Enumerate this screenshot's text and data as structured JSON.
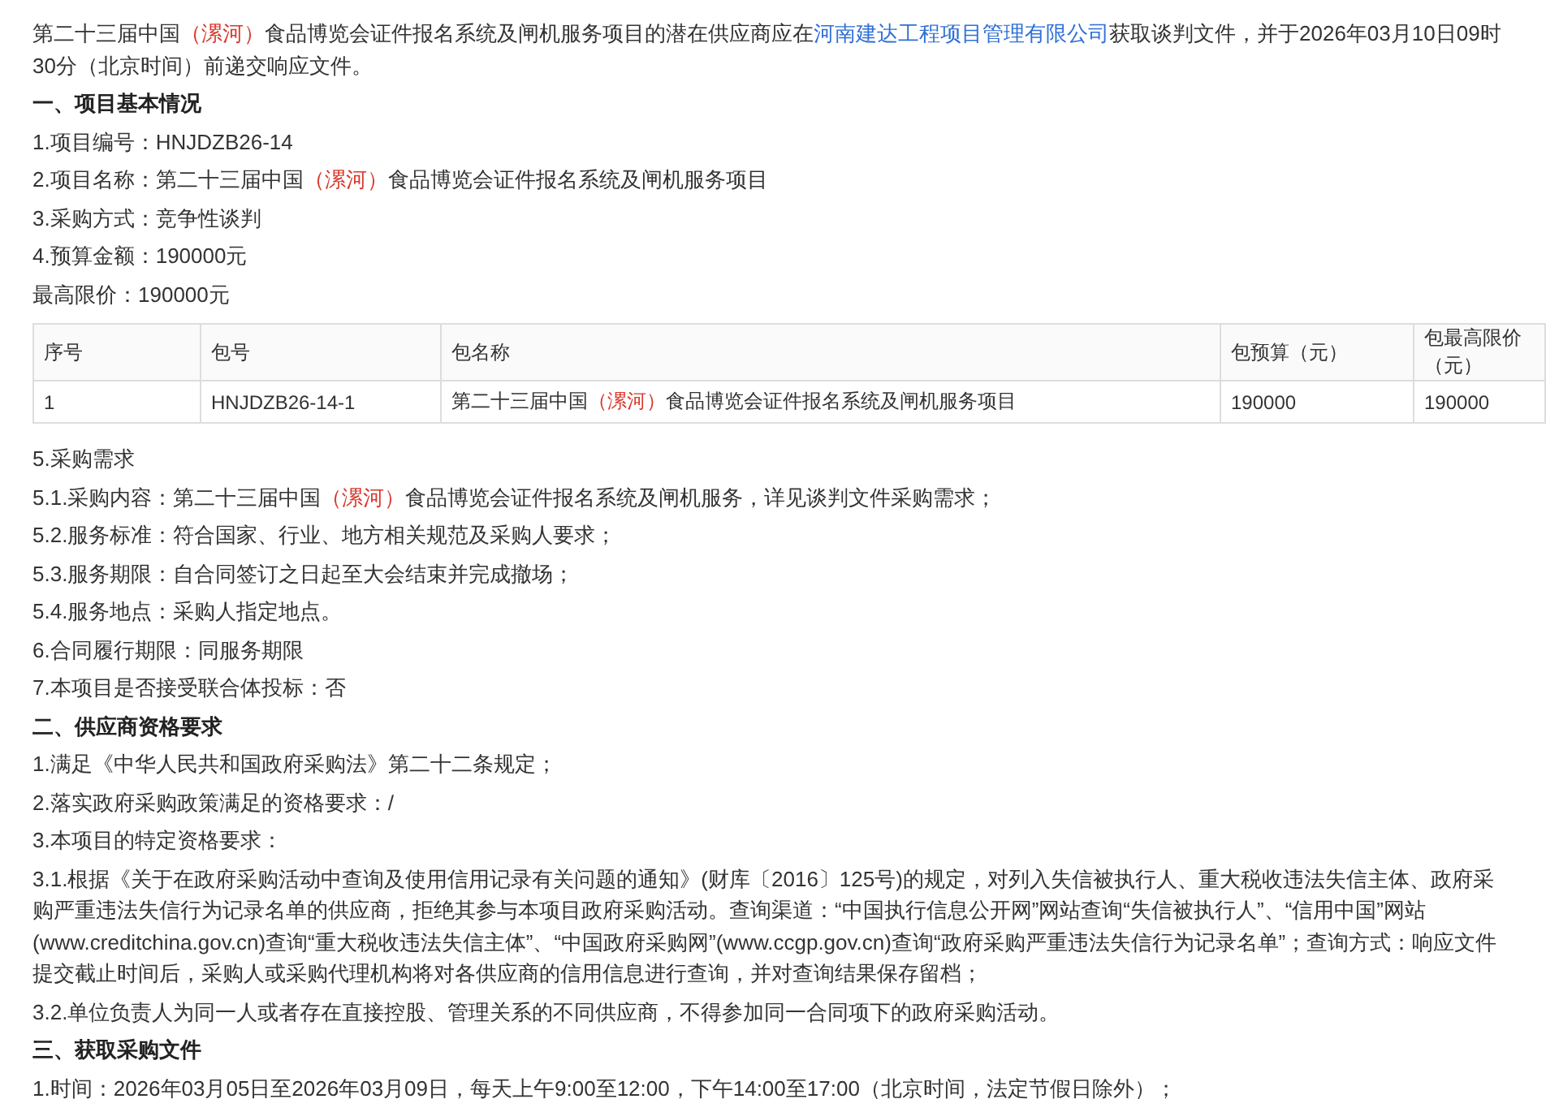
{
  "blocks": [
    {
      "kind": "paragraph",
      "segments": [
        {
          "kind": "text",
          "text": "第二十三届中国"
        },
        {
          "kind": "region",
          "text": "（漯河）"
        },
        {
          "kind": "text",
          "text": "食品博览会证件报名系统及闸机服务项目的潜在供应商应在"
        },
        {
          "kind": "link",
          "text": "河南建达工程项目管理有限公司"
        },
        {
          "kind": "text",
          "text": "获取谈判文件，并于2026年03月10日09时30分（北京时间）前递交响应文件。"
        }
      ]
    },
    {
      "kind": "heading",
      "segments": [
        {
          "kind": "text",
          "text": "一、项目基本情况"
        }
      ]
    },
    {
      "kind": "paragraph",
      "segments": [
        {
          "kind": "text",
          "text": "1.项目编号：HNJDZB26-14"
        }
      ]
    },
    {
      "kind": "paragraph",
      "segments": [
        {
          "kind": "text",
          "text": "2.项目名称：第二十三届中国"
        },
        {
          "kind": "region",
          "text": "（漯河）"
        },
        {
          "kind": "text",
          "text": "食品博览会证件报名系统及闸机服务项目"
        }
      ]
    },
    {
      "kind": "paragraph",
      "segments": [
        {
          "kind": "text",
          "text": "3.采购方式：竞争性谈判"
        }
      ]
    },
    {
      "kind": "paragraph",
      "segments": [
        {
          "kind": "text",
          "text": "4.预算金额：190000元"
        }
      ]
    },
    {
      "kind": "paragraph",
      "segments": [
        {
          "kind": "text",
          "text": "最高限价：190000元"
        }
      ]
    },
    {
      "kind": "table",
      "columns": [
        "序号",
        "包号",
        "包名称",
        "包预算（元）",
        "包最高限价（元）"
      ],
      "rows": [
        [
          [
            {
              "kind": "text",
              "text": "1"
            }
          ],
          [
            {
              "kind": "text",
              "text": "HNJDZB26-14-1"
            }
          ],
          [
            {
              "kind": "text",
              "text": "第二十三届中国"
            },
            {
              "kind": "region",
              "text": "（漯河）"
            },
            {
              "kind": "text",
              "text": "食品博览会证件报名系统及闸机服务项目"
            }
          ],
          [
            {
              "kind": "text",
              "text": "190000"
            }
          ],
          [
            {
              "kind": "text",
              "text": "190000"
            }
          ]
        ]
      ]
    },
    {
      "kind": "paragraph",
      "segments": [
        {
          "kind": "text",
          "text": "5.采购需求"
        }
      ]
    },
    {
      "kind": "paragraph",
      "segments": [
        {
          "kind": "text",
          "text": "5.1.采购内容：第二十三届中国"
        },
        {
          "kind": "region",
          "text": "（漯河）"
        },
        {
          "kind": "text",
          "text": "食品博览会证件报名系统及闸机服务，详见谈判文件采购需求；"
        }
      ]
    },
    {
      "kind": "paragraph",
      "segments": [
        {
          "kind": "text",
          "text": "5.2.服务标准：符合国家、行业、地方相关规范及采购人要求；"
        }
      ]
    },
    {
      "kind": "paragraph",
      "segments": [
        {
          "kind": "text",
          "text": "5.3.服务期限：自合同签订之日起至大会结束并完成撤场；"
        }
      ]
    },
    {
      "kind": "paragraph",
      "segments": [
        {
          "kind": "text",
          "text": "5.4.服务地点：采购人指定地点。"
        }
      ]
    },
    {
      "kind": "paragraph",
      "segments": [
        {
          "kind": "text",
          "text": "6.合同履行期限：同服务期限"
        }
      ]
    },
    {
      "kind": "paragraph",
      "segments": [
        {
          "kind": "text",
          "text": "7.本项目是否接受联合体投标：否"
        }
      ]
    },
    {
      "kind": "heading",
      "segments": [
        {
          "kind": "text",
          "text": "二、供应商资格要求"
        }
      ]
    },
    {
      "kind": "paragraph",
      "segments": [
        {
          "kind": "text",
          "text": "1.满足《中华人民共和国政府采购法》第二十二条规定；"
        }
      ]
    },
    {
      "kind": "paragraph",
      "segments": [
        {
          "kind": "text",
          "text": "2.落实政府采购政策满足的资格要求：/"
        }
      ]
    },
    {
      "kind": "paragraph",
      "segments": [
        {
          "kind": "text",
          "text": "3.本项目的特定资格要求："
        }
      ]
    },
    {
      "kind": "paragraph",
      "segments": [
        {
          "kind": "text",
          "text": "3.1.根据《关于在政府采购活动中查询及使用信用记录有关问题的通知》(财库〔2016〕125号)的规定，对列入失信被执行人、重大税收违法失信主体、政府采购严重违法失信行为记录名单的供应商，拒绝其参与本项目政府采购活动。查询渠道：“中国执行信息公开网”网站查询“失信被执行人”、“信用中国”网站(www.creditchina.gov.cn)查询“重大税收违法失信主体”、“中国政府采购网”(www.ccgp.gov.cn)查询“政府采购严重违法失信行为记录名单”；查询方式：响应文件提交截止时间后，采购人或采购代理机构将对各供应商的信用信息进行查询，并对查询结果保存留档；"
        }
      ]
    },
    {
      "kind": "paragraph",
      "segments": [
        {
          "kind": "text",
          "text": "3.2.单位负责人为同一人或者存在直接控股、管理关系的不同供应商，不得参加同一合同项下的政府采购活动。"
        }
      ]
    },
    {
      "kind": "heading",
      "segments": [
        {
          "kind": "text",
          "text": "三、获取采购文件"
        }
      ]
    },
    {
      "kind": "paragraph",
      "segments": [
        {
          "kind": "text",
          "text": "1.时间：2026年03月05日至2026年03月09日，每天上午9:00至12:00，下午14:00至17:00（北京时间，法定节假日除外）；"
        }
      ]
    }
  ]
}
